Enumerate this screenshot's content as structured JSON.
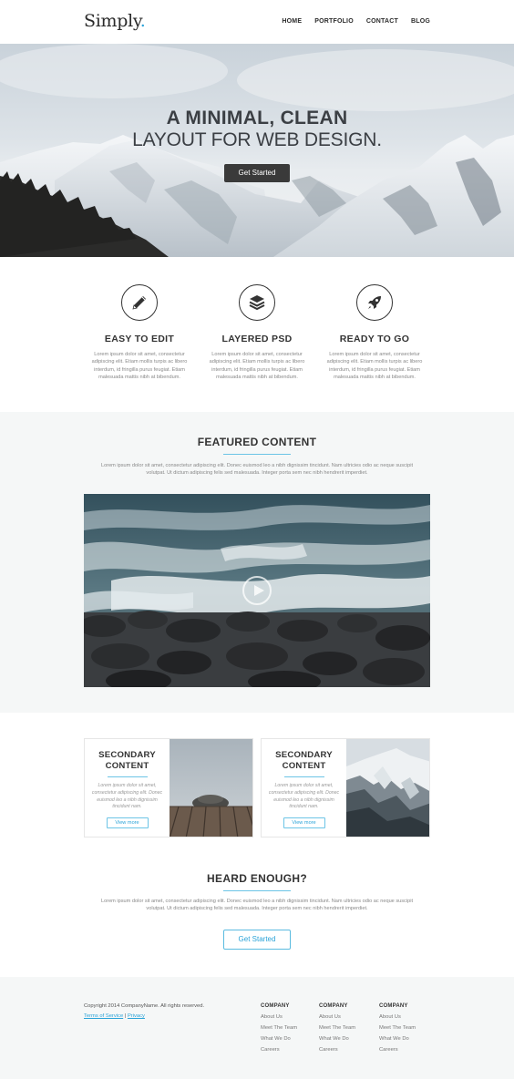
{
  "header": {
    "logo_text": "Simply",
    "logo_dot": ".",
    "nav": [
      "HOME",
      "PORTFOLIO",
      "CONTACT",
      "BLOG"
    ]
  },
  "hero": {
    "title_line1": "A MINIMAL, CLEAN",
    "title_line2": "LAYOUT FOR WEB DESIGN.",
    "button_label": "Get Started"
  },
  "features": [
    {
      "icon": "pencil-icon",
      "title": "EASY TO EDIT",
      "text": "Lorem ipsum dolor sit amet, consectetur adipiscing elit. Etiam mollis turpis ac libero interdum, id fringilla purus feugiat. Etiam malesuada mattis nibh at bibendum."
    },
    {
      "icon": "layers-icon",
      "title": "LAYERED PSD",
      "text": "Lorem ipsum dolor sit amet, consectetur adipiscing elit. Etiam mollis turpis ac libero interdum, id fringilla purus feugiat. Etiam malesuada mattis nibh at bibendum."
    },
    {
      "icon": "rocket-icon",
      "title": "READY TO GO",
      "text": "Lorem ipsum dolor sit amet, consectetur adipiscing elit. Etiam mollis turpis ac libero interdum, id fringilla purus feugiat. Etiam malesuada mattis nibh at bibendum."
    }
  ],
  "featured": {
    "title": "FEATURED CONTENT",
    "text": "Lorem ipsum dolor sit amet, consectetur adipiscing elit. Donec euismod leo a nibh dignissim tincidunt. Nam ultricies odio ac neque suscipit volutpat. Ut dictum adipiscing felis sed malesuada. Integer porta sem nec nibh hendrerit imperdiet."
  },
  "secondary": [
    {
      "title_line1": "SECONDARY",
      "title_line2": "CONTENT",
      "text": "Lorem ipsum dolor sit amet, consectetur adipiscing elit. Donec euismod leo a nibh dignissim tincidunt nam.",
      "button_label": "View more"
    },
    {
      "title_line1": "SECONDARY",
      "title_line2": "CONTENT",
      "text": "Lorem ipsum dolor sit amet, consectetur adipiscing elit. Donec euismod leo a nibh dignissim tincidunt nam.",
      "button_label": "View more"
    }
  ],
  "heard": {
    "title": "HEARD ENOUGH?",
    "text": "Lorem ipsum dolor sit amet, consectetur adipiscing elit. Donec euismod leo a nibh dignissim tincidunt. Nam ultricies odio ac neque suscipit volutpat. Ut dictum adipiscing felis sed malesuada. Integer porta sem nec nibh hendrerit imperdiet.",
    "button_label": "Get Started"
  },
  "footer": {
    "copyright": "Copyright 2014 CompanyName. All rights reserved.",
    "terms_label": "Terms of Service",
    "separator": "|",
    "privacy_label": "Privacy",
    "columns": [
      {
        "title": "COMPANY",
        "items": [
          "About Us",
          "Meet The Team",
          "What We Do",
          "Careers"
        ]
      },
      {
        "title": "COMPANY",
        "items": [
          "About Us",
          "Meet The Team",
          "What We Do",
          "Careers"
        ]
      },
      {
        "title": "COMPANY",
        "items": [
          "About Us",
          "Meet The Team",
          "What We Do",
          "Careers"
        ]
      }
    ]
  },
  "colors": {
    "accent": "#2aa3d8",
    "rule": "#6cc4e6",
    "dark": "#333333",
    "section_bg": "#f5f7f7"
  }
}
